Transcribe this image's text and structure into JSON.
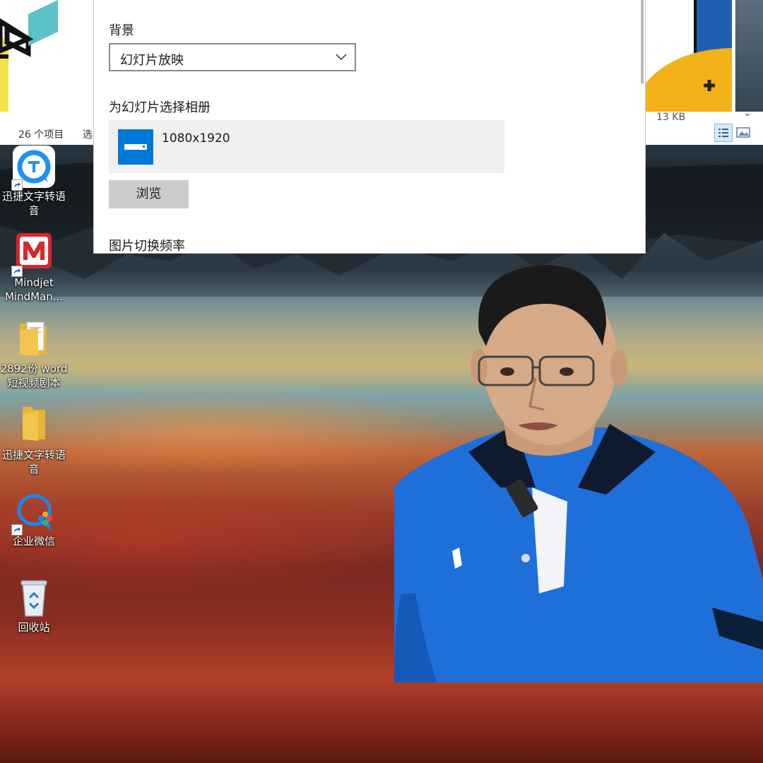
{
  "explorer": {
    "item_count": "26 个项目",
    "selected": "选",
    "file_size": "13 KB",
    "chevron": "⌄"
  },
  "settings": {
    "background_label": "背景",
    "background_value": "幻灯片放映",
    "album_label": "为幻灯片选择相册",
    "album_name": "1080x1920",
    "browse_label": "浏览",
    "interval_label": "图片切换频率"
  },
  "desktop": {
    "icons": [
      {
        "label_line1": "迅捷文字转语",
        "label_line2": "音",
        "icon": "xunjie-tts-app-icon"
      },
      {
        "label_line1": "Mindjet",
        "label_line2": "MindMan...",
        "icon": "mindjet-app-icon"
      },
      {
        "label_line1": "2892份 word",
        "label_line2": "短视频剧本",
        "icon": "folder-icon"
      },
      {
        "label_line1": "迅捷文字转语",
        "label_line2": "音",
        "icon": "folder-icon"
      },
      {
        "label_line1": "企业微信",
        "label_line2": "",
        "icon": "wecom-app-icon"
      },
      {
        "label_line1": "回收站",
        "label_line2": "",
        "icon": "recycle-bin-icon"
      }
    ]
  },
  "colors": {
    "accent_blue": "#0078d7",
    "mindjet_red": "#d7262b",
    "folder_yellow": "#f3c54e"
  }
}
